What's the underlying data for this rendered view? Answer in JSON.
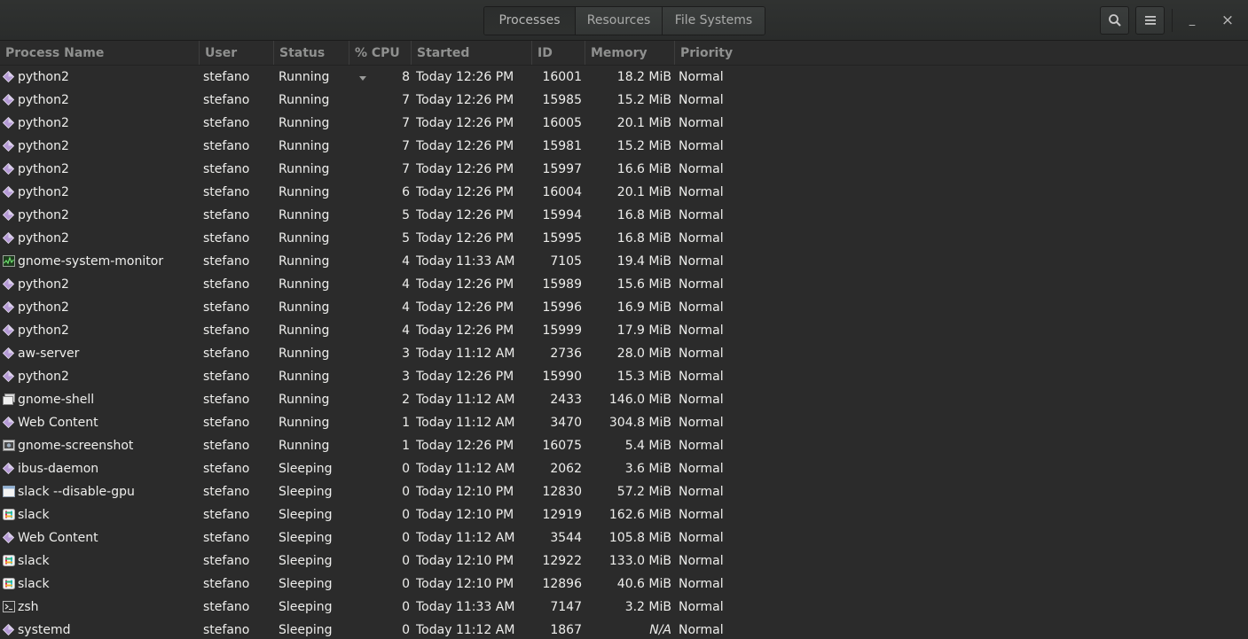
{
  "header": {
    "tabs": [
      {
        "label": "Processes",
        "active": true
      },
      {
        "label": "Resources",
        "active": false
      },
      {
        "label": "File Systems",
        "active": false
      }
    ],
    "search_icon": "search-icon",
    "menu_icon": "hamburger-menu-icon",
    "minimize_glyph": "_",
    "close_glyph": "×"
  },
  "columns": {
    "name": "Process Name",
    "user": "User",
    "status": "Status",
    "cpu": "% CPU",
    "started": "Started",
    "id": "ID",
    "memory": "Memory",
    "priority": "Priority"
  },
  "sort": {
    "column": "cpu",
    "direction": "descending"
  },
  "processes": [
    {
      "name": "python2",
      "icon": "generic-process",
      "user": "stefano",
      "status": "Running",
      "cpu": "8",
      "started": "Today 12:26 PM",
      "id": "16001",
      "memory": "18.2 MiB",
      "priority": "Normal"
    },
    {
      "name": "python2",
      "icon": "generic-process",
      "user": "stefano",
      "status": "Running",
      "cpu": "7",
      "started": "Today 12:26 PM",
      "id": "15985",
      "memory": "15.2 MiB",
      "priority": "Normal"
    },
    {
      "name": "python2",
      "icon": "generic-process",
      "user": "stefano",
      "status": "Running",
      "cpu": "7",
      "started": "Today 12:26 PM",
      "id": "16005",
      "memory": "20.1 MiB",
      "priority": "Normal"
    },
    {
      "name": "python2",
      "icon": "generic-process",
      "user": "stefano",
      "status": "Running",
      "cpu": "7",
      "started": "Today 12:26 PM",
      "id": "15981",
      "memory": "15.2 MiB",
      "priority": "Normal"
    },
    {
      "name": "python2",
      "icon": "generic-process",
      "user": "stefano",
      "status": "Running",
      "cpu": "7",
      "started": "Today 12:26 PM",
      "id": "15997",
      "memory": "16.6 MiB",
      "priority": "Normal"
    },
    {
      "name": "python2",
      "icon": "generic-process",
      "user": "stefano",
      "status": "Running",
      "cpu": "6",
      "started": "Today 12:26 PM",
      "id": "16004",
      "memory": "20.1 MiB",
      "priority": "Normal"
    },
    {
      "name": "python2",
      "icon": "generic-process",
      "user": "stefano",
      "status": "Running",
      "cpu": "5",
      "started": "Today 12:26 PM",
      "id": "15994",
      "memory": "16.8 MiB",
      "priority": "Normal"
    },
    {
      "name": "python2",
      "icon": "generic-process",
      "user": "stefano",
      "status": "Running",
      "cpu": "5",
      "started": "Today 12:26 PM",
      "id": "15995",
      "memory": "16.8 MiB",
      "priority": "Normal"
    },
    {
      "name": "gnome-system-monitor",
      "icon": "system-monitor",
      "user": "stefano",
      "status": "Running",
      "cpu": "4",
      "started": "Today 11:33 AM",
      "id": "7105",
      "memory": "19.4 MiB",
      "priority": "Normal"
    },
    {
      "name": "python2",
      "icon": "generic-process",
      "user": "stefano",
      "status": "Running",
      "cpu": "4",
      "started": "Today 12:26 PM",
      "id": "15989",
      "memory": "15.6 MiB",
      "priority": "Normal"
    },
    {
      "name": "python2",
      "icon": "generic-process",
      "user": "stefano",
      "status": "Running",
      "cpu": "4",
      "started": "Today 12:26 PM",
      "id": "15996",
      "memory": "16.9 MiB",
      "priority": "Normal"
    },
    {
      "name": "python2",
      "icon": "generic-process",
      "user": "stefano",
      "status": "Running",
      "cpu": "4",
      "started": "Today 12:26 PM",
      "id": "15999",
      "memory": "17.9 MiB",
      "priority": "Normal"
    },
    {
      "name": "aw-server",
      "icon": "generic-process",
      "user": "stefano",
      "status": "Running",
      "cpu": "3",
      "started": "Today 11:12 AM",
      "id": "2736",
      "memory": "28.0 MiB",
      "priority": "Normal"
    },
    {
      "name": "python2",
      "icon": "generic-process",
      "user": "stefano",
      "status": "Running",
      "cpu": "3",
      "started": "Today 12:26 PM",
      "id": "15990",
      "memory": "15.3 MiB",
      "priority": "Normal"
    },
    {
      "name": "gnome-shell",
      "icon": "gnome-shell",
      "user": "stefano",
      "status": "Running",
      "cpu": "2",
      "started": "Today 11:12 AM",
      "id": "2433",
      "memory": "146.0 MiB",
      "priority": "Normal"
    },
    {
      "name": "Web Content",
      "icon": "generic-process",
      "user": "stefano",
      "status": "Running",
      "cpu": "1",
      "started": "Today 11:12 AM",
      "id": "3470",
      "memory": "304.8 MiB",
      "priority": "Normal"
    },
    {
      "name": "gnome-screenshot",
      "icon": "screenshot",
      "user": "stefano",
      "status": "Running",
      "cpu": "1",
      "started": "Today 12:26 PM",
      "id": "16075",
      "memory": "5.4 MiB",
      "priority": "Normal"
    },
    {
      "name": "ibus-daemon",
      "icon": "generic-process",
      "user": "stefano",
      "status": "Sleeping",
      "cpu": "0",
      "started": "Today 11:12 AM",
      "id": "2062",
      "memory": "3.6 MiB",
      "priority": "Normal"
    },
    {
      "name": "slack --disable-gpu",
      "icon": "window",
      "user": "stefano",
      "status": "Sleeping",
      "cpu": "0",
      "started": "Today 12:10 PM",
      "id": "12830",
      "memory": "57.2 MiB",
      "priority": "Normal"
    },
    {
      "name": "slack",
      "icon": "slack",
      "user": "stefano",
      "status": "Sleeping",
      "cpu": "0",
      "started": "Today 12:10 PM",
      "id": "12919",
      "memory": "162.6 MiB",
      "priority": "Normal"
    },
    {
      "name": "Web Content",
      "icon": "generic-process",
      "user": "stefano",
      "status": "Sleeping",
      "cpu": "0",
      "started": "Today 11:12 AM",
      "id": "3544",
      "memory": "105.8 MiB",
      "priority": "Normal"
    },
    {
      "name": "slack",
      "icon": "slack",
      "user": "stefano",
      "status": "Sleeping",
      "cpu": "0",
      "started": "Today 12:10 PM",
      "id": "12922",
      "memory": "133.0 MiB",
      "priority": "Normal"
    },
    {
      "name": "slack",
      "icon": "slack",
      "user": "stefano",
      "status": "Sleeping",
      "cpu": "0",
      "started": "Today 12:10 PM",
      "id": "12896",
      "memory": "40.6 MiB",
      "priority": "Normal"
    },
    {
      "name": "zsh",
      "icon": "terminal",
      "user": "stefano",
      "status": "Sleeping",
      "cpu": "0",
      "started": "Today 11:33 AM",
      "id": "7147",
      "memory": "3.2 MiB",
      "priority": "Normal"
    },
    {
      "name": "systemd",
      "icon": "generic-process",
      "user": "stefano",
      "status": "Sleeping",
      "cpu": "0",
      "started": "Today 11:12 AM",
      "id": "1867",
      "memory": "N/A",
      "priority": "Normal"
    }
  ],
  "colors": {
    "background": "#2b2b2b",
    "text": "#eeeeec",
    "header_text": "#8f908f",
    "generic_icon": "#b59ad6"
  }
}
